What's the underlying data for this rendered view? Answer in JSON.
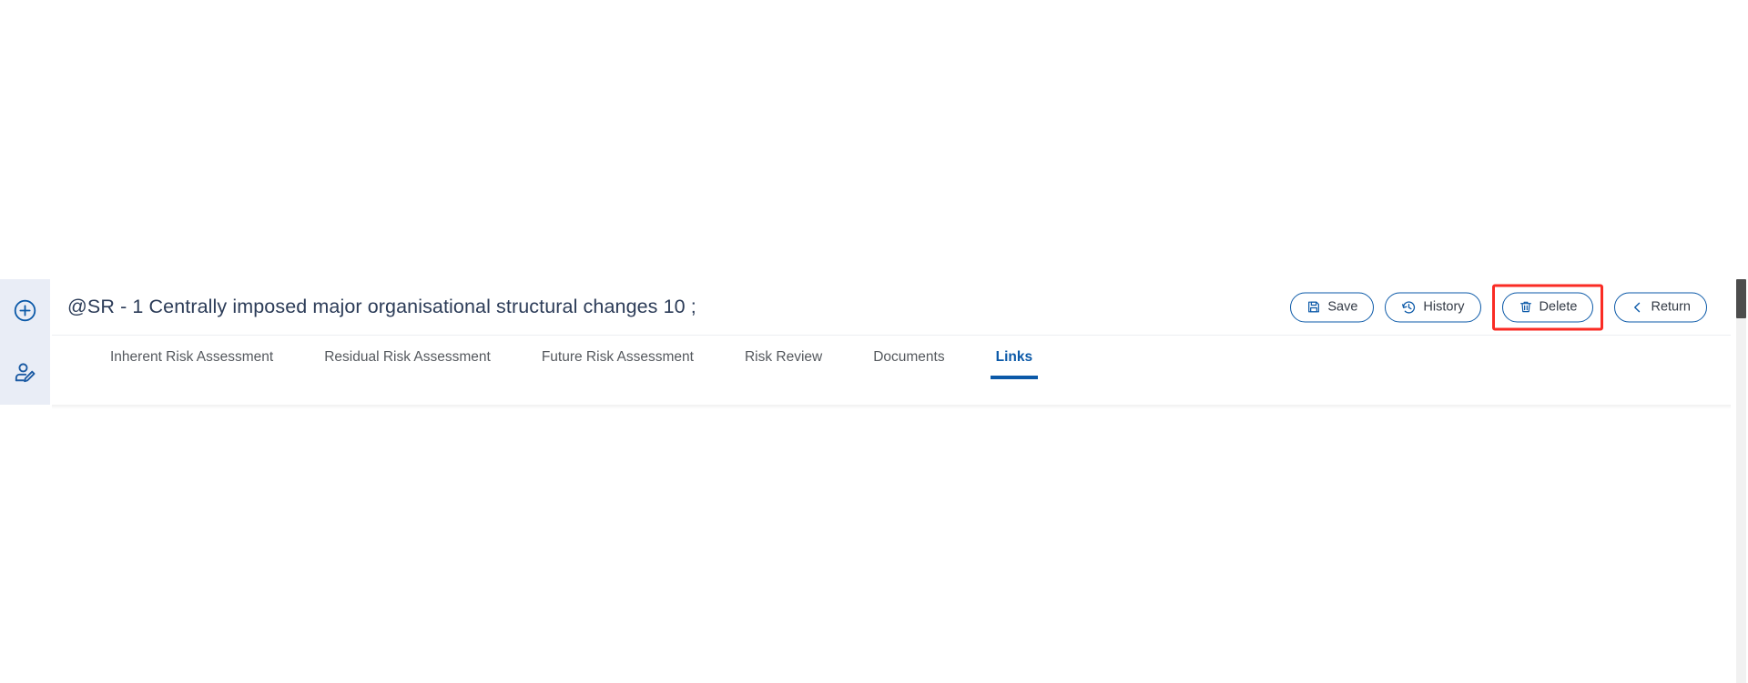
{
  "left_rail": {
    "items": [
      {
        "icon": "plus-circle-icon",
        "name": "add-item-button"
      },
      {
        "icon": "user-edit-icon",
        "name": "assign-owner-button"
      }
    ]
  },
  "header": {
    "title": "@SR - 1 Centrally imposed major organisational structural changes 10 ;",
    "buttons": [
      {
        "label": "Save",
        "icon": "floppy-disk-icon",
        "highlighted": false
      },
      {
        "label": "History",
        "icon": "clock-history-icon",
        "highlighted": false
      },
      {
        "label": "Delete",
        "icon": "trash-icon",
        "highlighted": true
      },
      {
        "label": "Return",
        "icon": "chevron-left-icon",
        "highlighted": false
      }
    ]
  },
  "tabs": [
    {
      "label": "Inherent Risk Assessment",
      "active": false
    },
    {
      "label": "Residual Risk Assessment",
      "active": false
    },
    {
      "label": "Future Risk Assessment",
      "active": false
    },
    {
      "label": "Risk Review",
      "active": false
    },
    {
      "label": "Documents",
      "active": false
    },
    {
      "label": "Links",
      "active": true
    }
  ],
  "colors": {
    "accent_blue": "#0b59a8",
    "rail_bg": "#e9edf6",
    "title_text": "#2c3c58",
    "tab_text": "#55595e",
    "highlight_red": "#fa2b24",
    "scrollbar_thumb": "#4d4d4d",
    "scrollbar_track": "#f1f1f1"
  }
}
